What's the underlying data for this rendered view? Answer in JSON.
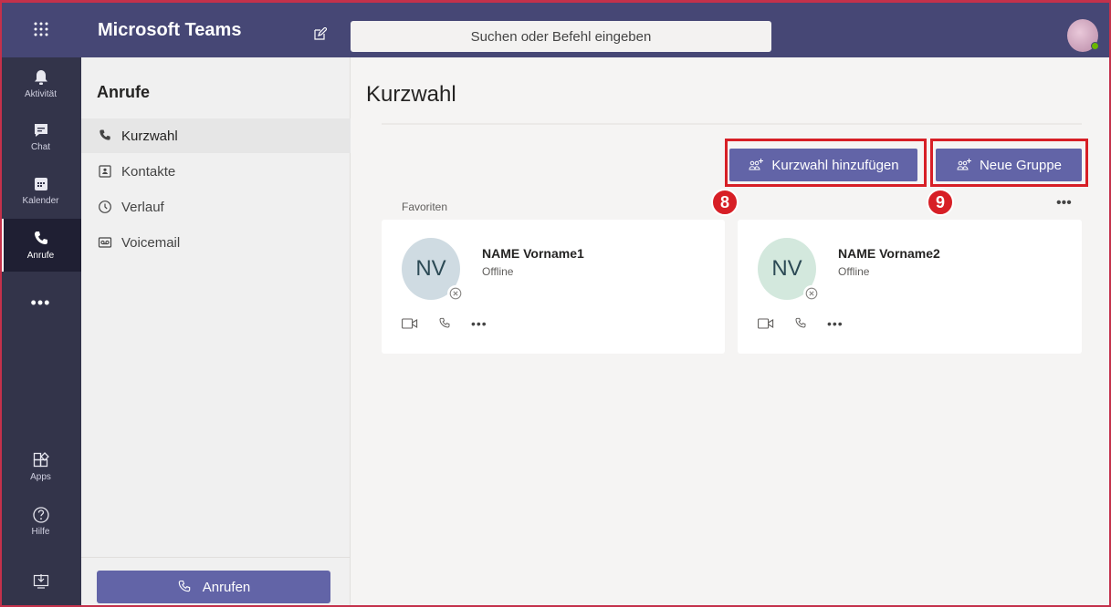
{
  "app": {
    "title": "Microsoft Teams",
    "search_placeholder": "Suchen oder Befehl eingeben"
  },
  "rail": [
    {
      "id": "aktivitaet",
      "label": "Aktivität",
      "icon": "bell-icon"
    },
    {
      "id": "chat",
      "label": "Chat",
      "icon": "chat-icon"
    },
    {
      "id": "kalender",
      "label": "Kalender",
      "icon": "calendar-icon"
    },
    {
      "id": "anrufe",
      "label": "Anrufe",
      "icon": "phone-icon",
      "active": true
    },
    {
      "id": "apps",
      "label": "Apps",
      "icon": "apps-icon"
    },
    {
      "id": "hilfe",
      "label": "Hilfe",
      "icon": "help-icon"
    }
  ],
  "panel": {
    "title": "Anrufe",
    "items": [
      {
        "label": "Kurzwahl",
        "icon": "phone-icon",
        "active": true
      },
      {
        "label": "Kontakte",
        "icon": "contact-card-icon"
      },
      {
        "label": "Verlauf",
        "icon": "clock-icon"
      },
      {
        "label": "Voicemail",
        "icon": "voicemail-icon"
      }
    ],
    "call_button": "Anrufen"
  },
  "main": {
    "title": "Kurzwahl",
    "add_speed_dial_button": "Kurzwahl hinzufügen",
    "new_group_button": "Neue Gruppe",
    "section_label": "Favoriten",
    "cards": [
      {
        "initials": "NV",
        "name": "NAME Vorname1",
        "status": "Offline",
        "avatar_color": "#cfdbe2"
      },
      {
        "initials": "NV",
        "name": "NAME Vorname2",
        "status": "Offline",
        "avatar_color": "#d3e8dd"
      }
    ]
  },
  "annotations": {
    "badge_add": "8",
    "badge_group": "9"
  },
  "colors": {
    "brand": "#464775",
    "accent": "#6264a7",
    "highlight": "#d71f26"
  }
}
